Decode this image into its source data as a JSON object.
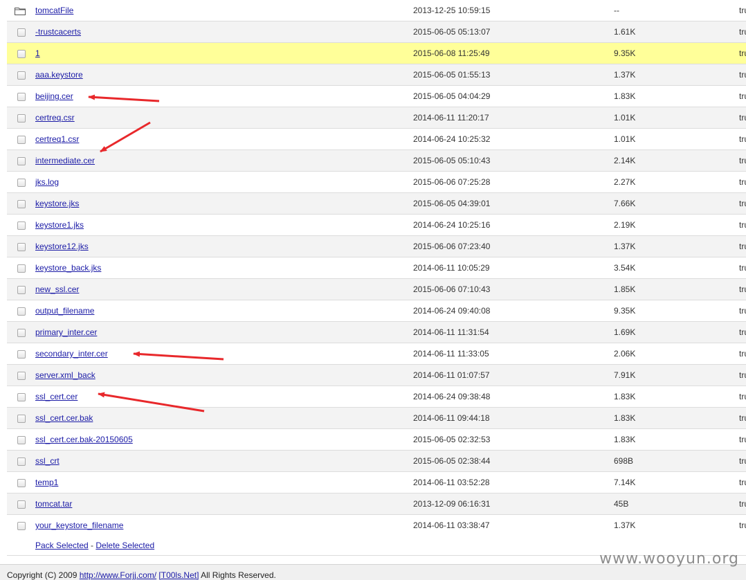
{
  "files": [
    {
      "name": "tomcatFile",
      "modified": "2013-12-25 10:59:15",
      "size": "--",
      "rest": "tru",
      "is_folder": true
    },
    {
      "name": "-trustcacerts",
      "modified": "2015-06-05 05:13:07",
      "size": "1.61K",
      "rest": "tru"
    },
    {
      "name": "1",
      "modified": "2015-06-08 11:25:49",
      "size": "9.35K",
      "rest": "tru",
      "highlighted": true
    },
    {
      "name": "aaa.keystore",
      "modified": "2015-06-05 01:55:13",
      "size": "1.37K",
      "rest": "tru"
    },
    {
      "name": "beijing.cer",
      "modified": "2015-06-05 04:04:29",
      "size": "1.83K",
      "rest": "tru"
    },
    {
      "name": "certreq.csr",
      "modified": "2014-06-11 11:20:17",
      "size": "1.01K",
      "rest": "tru"
    },
    {
      "name": "certreq1.csr",
      "modified": "2014-06-24 10:25:32",
      "size": "1.01K",
      "rest": "tru"
    },
    {
      "name": "intermediate.cer",
      "modified": "2015-06-05 05:10:43",
      "size": "2.14K",
      "rest": "tru"
    },
    {
      "name": "jks.log",
      "modified": "2015-06-06 07:25:28",
      "size": "2.27K",
      "rest": "tru"
    },
    {
      "name": "keystore.jks",
      "modified": "2015-06-05 04:39:01",
      "size": "7.66K",
      "rest": "tru"
    },
    {
      "name": "keystore1.jks",
      "modified": "2014-06-24 10:25:16",
      "size": "2.19K",
      "rest": "tru"
    },
    {
      "name": "keystore12.jks",
      "modified": "2015-06-06 07:23:40",
      "size": "1.37K",
      "rest": "tru"
    },
    {
      "name": "keystore_back.jks",
      "modified": "2014-06-11 10:05:29",
      "size": "3.54K",
      "rest": "tru"
    },
    {
      "name": "new_ssl.cer",
      "modified": "2015-06-06 07:10:43",
      "size": "1.85K",
      "rest": "tru"
    },
    {
      "name": "output_filename",
      "modified": "2014-06-24 09:40:08",
      "size": "9.35K",
      "rest": "tru"
    },
    {
      "name": "primary_inter.cer",
      "modified": "2014-06-11 11:31:54",
      "size": "1.69K",
      "rest": "tru"
    },
    {
      "name": "secondary_inter.cer",
      "modified": "2014-06-11 11:33:05",
      "size": "2.06K",
      "rest": "tru"
    },
    {
      "name": "server.xml_back",
      "modified": "2014-06-11 01:07:57",
      "size": "7.91K",
      "rest": "tru"
    },
    {
      "name": "ssl_cert.cer",
      "modified": "2014-06-24 09:38:48",
      "size": "1.83K",
      "rest": "tru"
    },
    {
      "name": "ssl_cert.cer.bak",
      "modified": "2014-06-11 09:44:18",
      "size": "1.83K",
      "rest": "tru"
    },
    {
      "name": "ssl_cert.cer.bak-20150605",
      "modified": "2015-06-05 02:32:53",
      "size": "1.83K",
      "rest": "tru"
    },
    {
      "name": "ssl_crt",
      "modified": "2015-06-05 02:38:44",
      "size": "698B",
      "rest": "tru"
    },
    {
      "name": "temp1",
      "modified": "2014-06-11 03:52:28",
      "size": "7.14K",
      "rest": "tru"
    },
    {
      "name": "tomcat.tar",
      "modified": "2013-12-09 06:16:31",
      "size": "45B",
      "rest": "tru"
    },
    {
      "name": "your_keystore_filename",
      "modified": "2014-06-11 03:38:47",
      "size": "1.37K",
      "rest": "tru"
    }
  ],
  "actions": {
    "pack_label": "Pack Selected",
    "separator": " - ",
    "delete_label": "Delete Selected"
  },
  "copyright": {
    "prefix": "Copyright (C) 2009 ",
    "link1": "http://www.Forjj.com/",
    "gap": " ",
    "link2": "[T00ls.Net]",
    "suffix": " All Rights Reserved."
  },
  "watermark": "www.wooyun.org",
  "colors": {
    "highlight_row": "#ffff99",
    "link": "#1a1aa6",
    "annotation_arrow": "#e8282b"
  },
  "annotations": {
    "arrow_targets": [
      "beijing.cer",
      "intermediate.cer",
      "secondary_inter.cer",
      "ssl_cert.cer"
    ]
  }
}
